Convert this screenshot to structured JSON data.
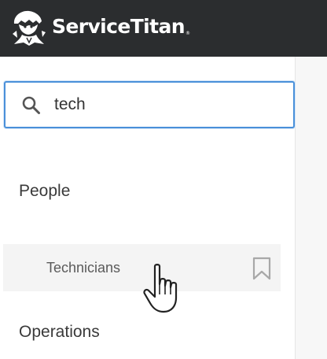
{
  "header": {
    "brand_name": "ServiceTitan",
    "trademark": "®",
    "logo_icon": "titan-logo-icon"
  },
  "search": {
    "value": "tech",
    "icon": "search-icon"
  },
  "results": {
    "sections": [
      {
        "label": "People",
        "items": [
          {
            "label": "Technicians",
            "icon": "bookmark-icon"
          }
        ]
      },
      {
        "label": "Operations",
        "items": []
      }
    ]
  },
  "colors": {
    "header_bg": "#2b2d2f",
    "focus_border": "#4a90d9",
    "hover_bg": "#f4f4f4"
  }
}
